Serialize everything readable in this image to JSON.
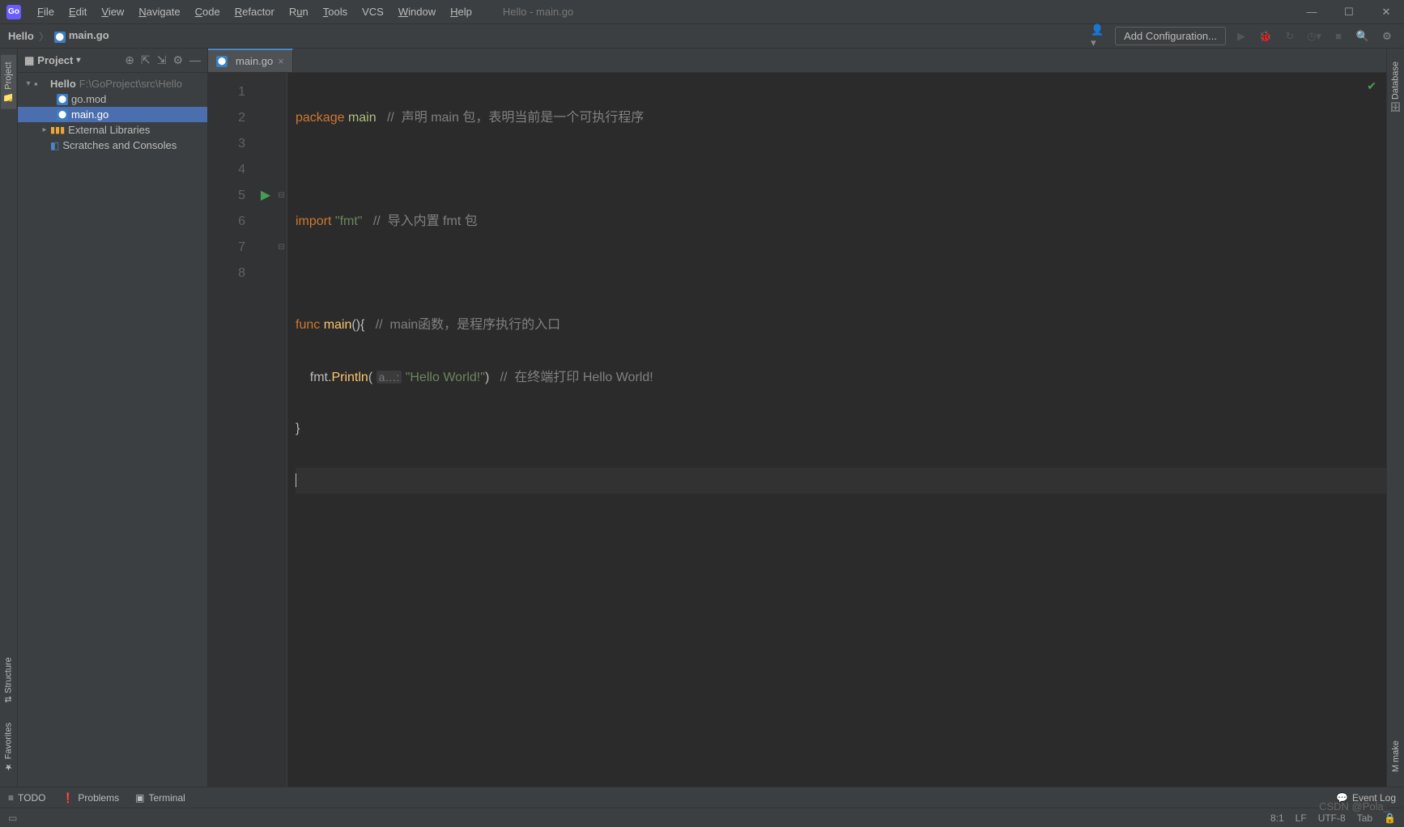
{
  "window": {
    "title": "Hello - main.go"
  },
  "menu": {
    "file": "File",
    "edit": "Edit",
    "view": "View",
    "navigate": "Navigate",
    "code": "Code",
    "refactor": "Refactor",
    "run": "Run",
    "tools": "Tools",
    "vcs": "VCS",
    "window": "Window",
    "help": "Help"
  },
  "breadcrumb": {
    "project": "Hello",
    "file": "main.go"
  },
  "toolbar": {
    "add_config": "Add Configuration..."
  },
  "left_rail": {
    "project": "Project",
    "structure": "Structure",
    "favorites": "Favorites"
  },
  "right_rail": {
    "database": "Database",
    "make": "make"
  },
  "project_panel": {
    "title": "Project",
    "root": {
      "name": "Hello",
      "path": "F:\\GoProject\\src\\Hello"
    },
    "files": {
      "gomod": "go.mod",
      "maingo": "main.go"
    },
    "external": "External Libraries",
    "scratches": "Scratches and Consoles"
  },
  "tab": {
    "name": "main.go"
  },
  "code": {
    "l1": {
      "kw": "package",
      "pkg": " main",
      "cmt": "//  声明 main 包，表明当前是一个可执行程序"
    },
    "l3": {
      "kw": "import",
      "str": " \"fmt\"",
      "cmt": "//  导入内置 fmt 包"
    },
    "l5": {
      "kw": "func",
      "fn": " main",
      "rest": "(){",
      "cmt": "//  main函数，是程序执行的入口"
    },
    "l6": {
      "pre": "    fmt.",
      "fn": "Println",
      "open": "( ",
      "hint": "a…:",
      "str": " \"Hello World!\"",
      "close": ")",
      "cmt": "//  在终端打印 Hello World!"
    },
    "l7": {
      "brace": "}"
    }
  },
  "line_numbers": [
    "1",
    "2",
    "3",
    "4",
    "5",
    "6",
    "7",
    "8"
  ],
  "bottom": {
    "todo": "TODO",
    "problems": "Problems",
    "terminal": "Terminal",
    "eventlog": "Event Log"
  },
  "status": {
    "pos": "8:1",
    "eol": "LF",
    "enc": "UTF-8",
    "indent": "Tab"
  },
  "watermark": "CSDN @Pola_"
}
